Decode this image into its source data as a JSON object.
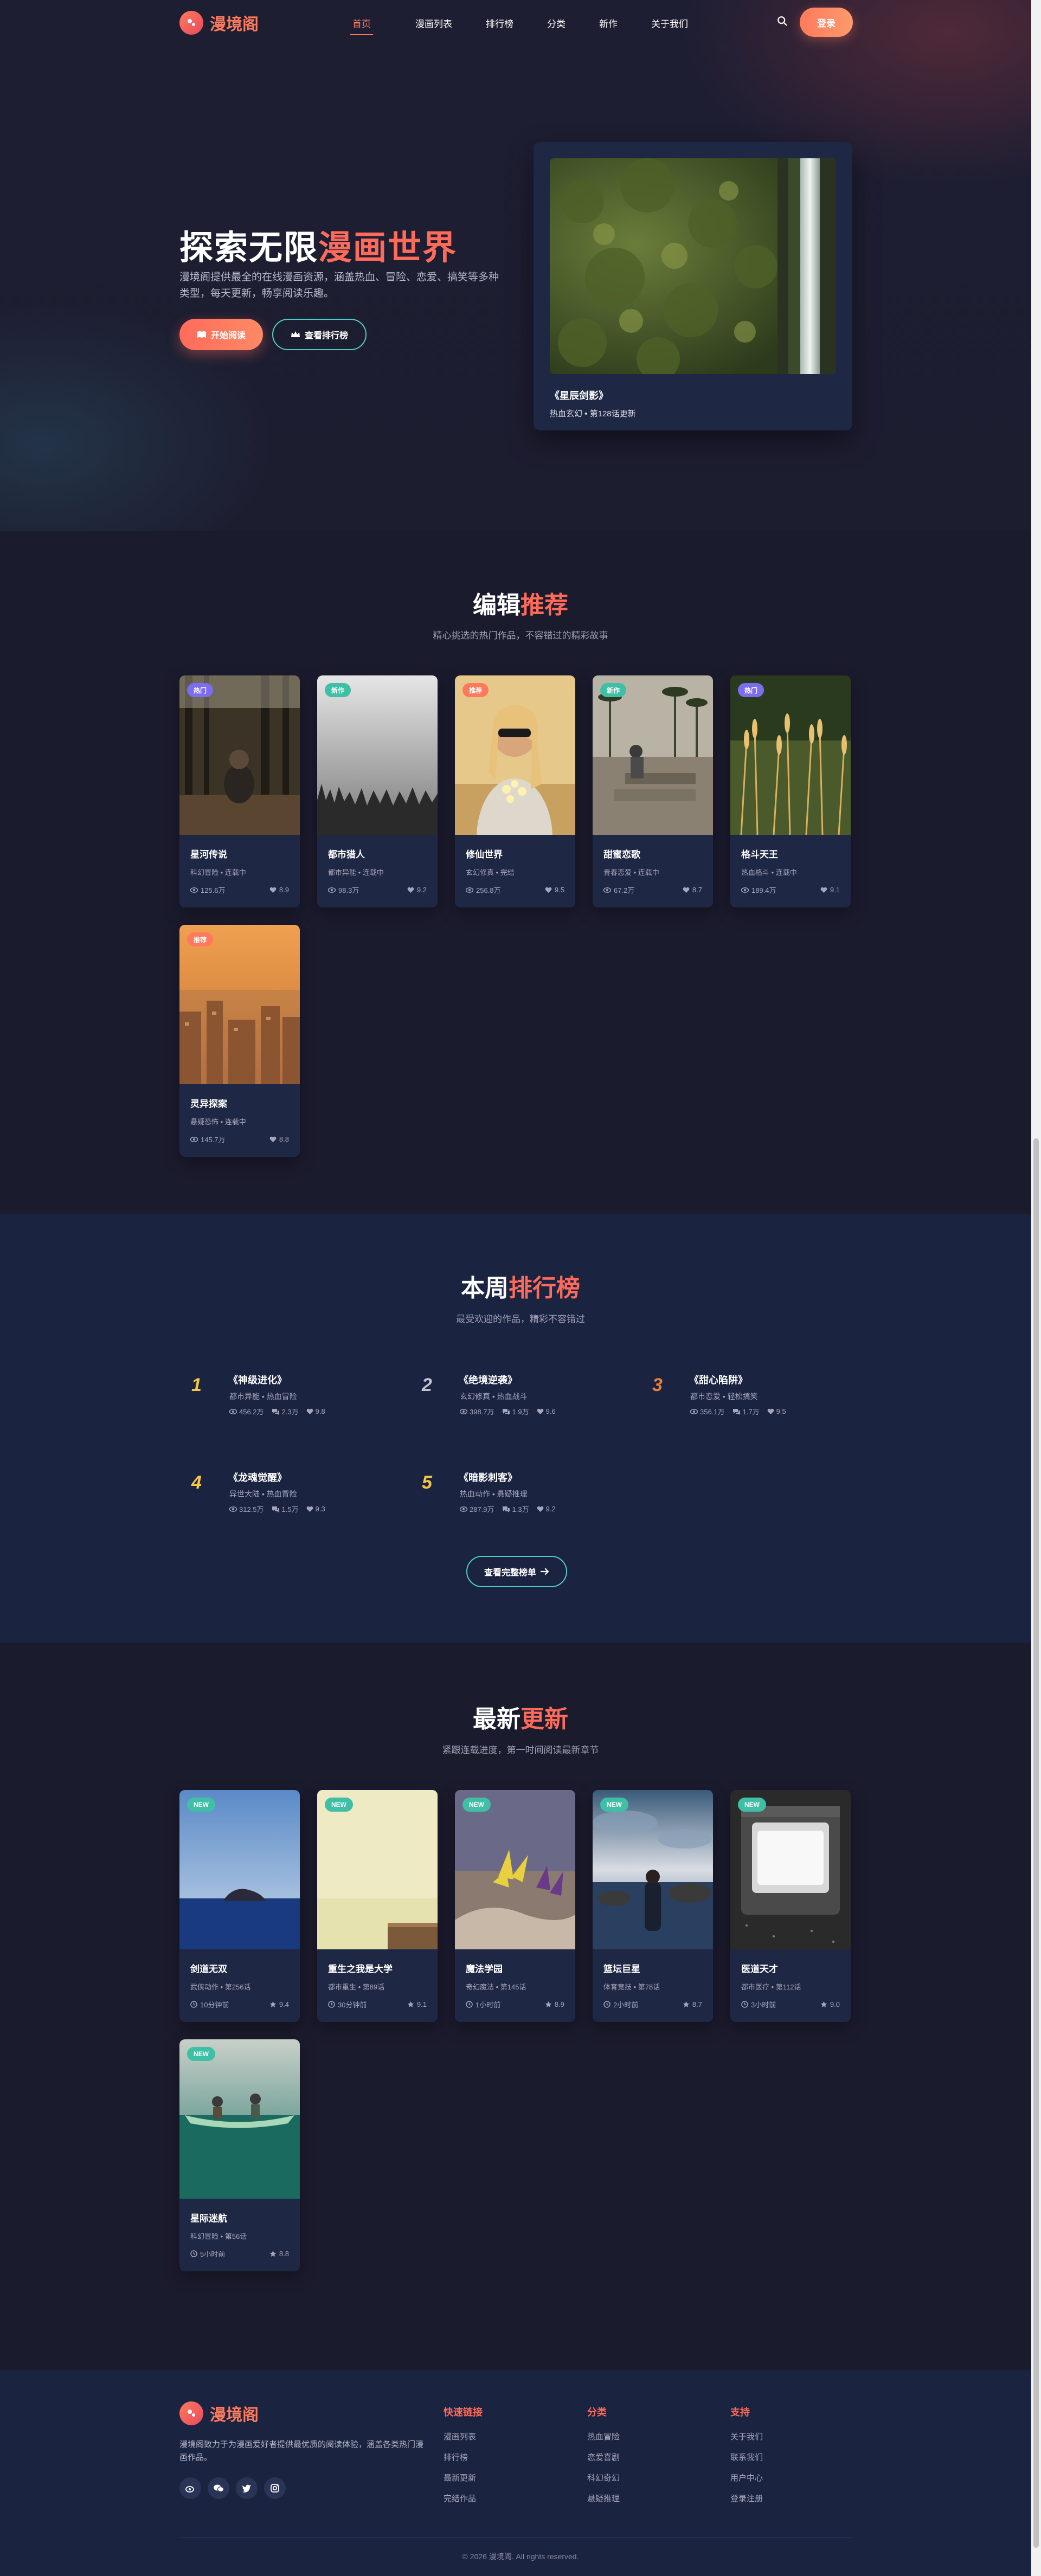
{
  "header": {
    "logo_text": "漫境阁",
    "nav": [
      "首页",
      "漫画列表",
      "排行榜",
      "分类",
      "新作",
      "关于我们"
    ],
    "login_label": "登录"
  },
  "hero": {
    "title_part1": "探索无限",
    "title_part2": "漫画世界",
    "desc": "漫境阁提供最全的在线漫画资源，涵盖热血、冒险、恋爱、搞笑等多种类型，每天更新，畅享阅读乐趣。",
    "btn_primary": "开始阅读",
    "btn_outline": "查看排行榜",
    "featured_title": "《星辰剑影》",
    "featured_meta": "热血玄幻 • 第128话更新"
  },
  "recommend": {
    "title_part1": "编辑",
    "title_part2": "推荐",
    "subtitle": "精心挑选的热门作品，不容错过的精彩故事",
    "cards": [
      {
        "badge": "热门",
        "badge_color": "#7b6cf0",
        "title": "星河传说",
        "meta": "科幻冒险 • 连载中",
        "views": "125.6万",
        "rating": "8.9"
      },
      {
        "badge": "新作",
        "badge_color": "#3fbfa5",
        "title": "都市猎人",
        "meta": "都市异能 • 连载中",
        "views": "98.3万",
        "rating": "9.2"
      },
      {
        "badge": "推荐",
        "badge_color": "#ff7a5c",
        "title": "修仙世界",
        "meta": "玄幻修真 • 完结",
        "views": "256.8万",
        "rating": "9.5"
      },
      {
        "badge": "新作",
        "badge_color": "#3fbfa5",
        "title": "甜蜜恋歌",
        "meta": "青春恋爱 • 连载中",
        "views": "67.2万",
        "rating": "8.7"
      },
      {
        "badge": "热门",
        "badge_color": "#7b6cf0",
        "title": "格斗天王",
        "meta": "热血格斗 • 连载中",
        "views": "189.4万",
        "rating": "9.1"
      },
      {
        "badge": "推荐",
        "badge_color": "#ff7a5c",
        "title": "灵异探案",
        "meta": "悬疑恐怖 • 连载中",
        "views": "145.7万",
        "rating": "8.8"
      }
    ]
  },
  "ranking": {
    "title_part1": "本周",
    "title_part2": "排行榜",
    "subtitle": "最受欢迎的作品，精彩不容错过",
    "items": [
      {
        "num": "1",
        "color": "#f5c842",
        "title": "《神级进化》",
        "meta": "都市异能 • 热血冒险",
        "views": "456.2万",
        "comments": "2.3万",
        "likes": "9.8"
      },
      {
        "num": "2",
        "color": "#c0c4d0",
        "title": "《绝境逆袭》",
        "meta": "玄幻修真 • 热血战斗",
        "views": "398.7万",
        "comments": "1.9万",
        "likes": "9.6"
      },
      {
        "num": "3",
        "color": "#e8803a",
        "title": "《甜心陷阱》",
        "meta": "都市恋爱 • 轻松搞笑",
        "views": "356.1万",
        "comments": "1.7万",
        "likes": "9.5"
      },
      {
        "num": "4",
        "color": "#f5c842",
        "title": "《龙魂觉醒》",
        "meta": "异世大陆 • 热血冒险",
        "views": "312.5万",
        "comments": "1.5万",
        "likes": "9.3"
      },
      {
        "num": "5",
        "color": "#f5c842",
        "title": "《暗影刺客》",
        "meta": "热血动作 • 悬疑推理",
        "views": "287.9万",
        "comments": "1.3万",
        "likes": "9.2"
      }
    ],
    "more_label": "查看完整榜单"
  },
  "latest": {
    "title_part1": "最新",
    "title_part2": "更新",
    "subtitle": "紧跟连载进度，第一时间阅读最新章节",
    "cards": [
      {
        "badge": "NEW",
        "title": "剑道无双",
        "meta": "武侠动作 • 第256话",
        "time": "10分钟前",
        "rating": "9.4"
      },
      {
        "badge": "NEW",
        "title": "重生之我是大学",
        "meta": "都市重生 • 第89话",
        "time": "30分钟前",
        "rating": "9.1"
      },
      {
        "badge": "NEW",
        "title": "魔法学园",
        "meta": "奇幻魔法 • 第145话",
        "time": "1小时前",
        "rating": "8.9"
      },
      {
        "badge": "NEW",
        "title": "篮坛巨星",
        "meta": "体育竞技 • 第78话",
        "time": "2小时前",
        "rating": "8.7"
      },
      {
        "badge": "NEW",
        "title": "医道天才",
        "meta": "都市医疗 • 第112话",
        "time": "3小时前",
        "rating": "9.0"
      },
      {
        "badge": "NEW",
        "title": "星际迷航",
        "meta": "科幻冒险 • 第56话",
        "time": "5小时前",
        "rating": "8.8"
      }
    ]
  },
  "footer": {
    "logo_text": "漫境阁",
    "desc": "漫境阁致力于为漫画爱好者提供最优质的阅读体验，涵盖各类热门漫画作品。",
    "cols": [
      {
        "title": "快速链接",
        "links": [
          "漫画列表",
          "排行榜",
          "最新更新",
          "完结作品"
        ]
      },
      {
        "title": "分类",
        "links": [
          "热血冒险",
          "恋爱喜剧",
          "科幻奇幻",
          "悬疑推理"
        ]
      },
      {
        "title": "支持",
        "links": [
          "关于我们",
          "联系我们",
          "用户中心",
          "登录注册"
        ]
      }
    ],
    "copyright": "© 2026 漫境阁. All rights reserved."
  }
}
